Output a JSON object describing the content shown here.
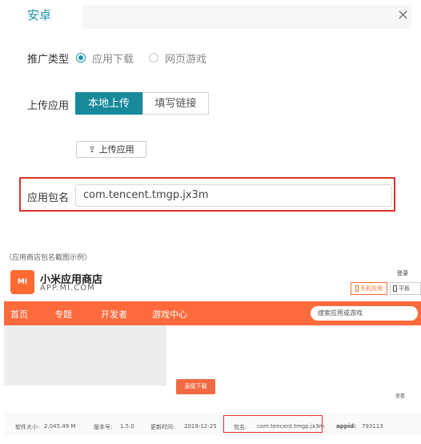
{
  "header": {
    "tab_label": "安卓",
    "close_glyph": "×"
  },
  "form": {
    "promo_type_label": "推广类型",
    "promo_options": [
      {
        "label": "应用下载",
        "selected": true
      },
      {
        "label": "网页游戏",
        "selected": false
      }
    ],
    "upload_label": "上传应用",
    "upload_tabs": [
      {
        "label": "本地上传",
        "active": true
      },
      {
        "label": "填写链接",
        "active": false
      }
    ],
    "upload_button_label": "上传应用",
    "package_label": "应用包名",
    "package_value": "com.tencent.tmgp.jx3m"
  },
  "caption": "（应用商店包名截图示例）",
  "store": {
    "logo_text": "MI",
    "name": "小米应用商店",
    "sub": "APP.MI.COM",
    "login_text": "登录",
    "phone_button": "手机应用",
    "pad_button": "平板",
    "nav": [
      "首页",
      "专题",
      "开发者",
      "游戏中心"
    ],
    "search_placeholder": "搜索应用或游戏",
    "download_button": "直接下载",
    "partial_text": "查看",
    "info": [
      {
        "key": "软件大小:",
        "value": "2,045.49 M"
      },
      {
        "key": "版本号:",
        "value": "1.5.0"
      },
      {
        "key": "更新时间:",
        "value": "2019-12-25"
      },
      {
        "key": "包名:",
        "value": "com.tencent.tmgp.jx3m"
      },
      {
        "key": "appid:",
        "value": "793113"
      }
    ]
  },
  "colors": {
    "accent": "#17899b",
    "highlight_red": "#e0312f",
    "mi_orange": "#ff6a3d"
  }
}
